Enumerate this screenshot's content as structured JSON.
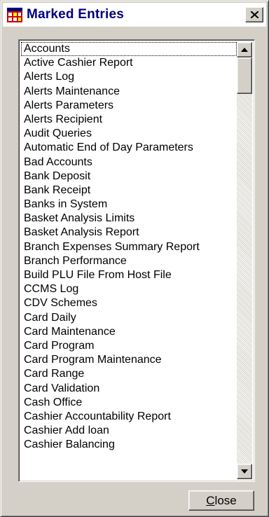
{
  "window": {
    "title": "Marked Entries",
    "icon": "app-grid-icon",
    "close_icon": "close-x-icon"
  },
  "list": {
    "items": [
      "Accounts",
      "Active Cashier Report",
      "Alerts Log",
      "Alerts Maintenance",
      "Alerts Parameters",
      "Alerts Recipient",
      "Audit Queries",
      "Automatic End of Day Parameters",
      "Bad Accounts",
      "Bank Deposit",
      "Bank Receipt",
      "Banks in System",
      "Basket Analysis Limits",
      "Basket Analysis Report",
      "Branch Expenses Summary Report",
      "Branch Performance",
      "Build PLU File From Host File",
      "CCMS Log",
      "CDV Schemes",
      "Card Daily",
      "Card Maintenance",
      "Card Program",
      "Card Program Maintenance",
      "Card Range",
      "Card Validation",
      "Cash Office",
      "Cashier Accountability Report",
      "Cashier Add loan",
      "Cashier Balancing"
    ],
    "focused_index": 0
  },
  "scrollbar": {
    "up_icon": "scroll-up-arrow-icon",
    "down_icon": "scroll-down-arrow-icon"
  },
  "buttons": {
    "close_accel": "C",
    "close_rest": "lose"
  },
  "colors": {
    "title_text": "#000080",
    "face": "#d4d0c8"
  }
}
